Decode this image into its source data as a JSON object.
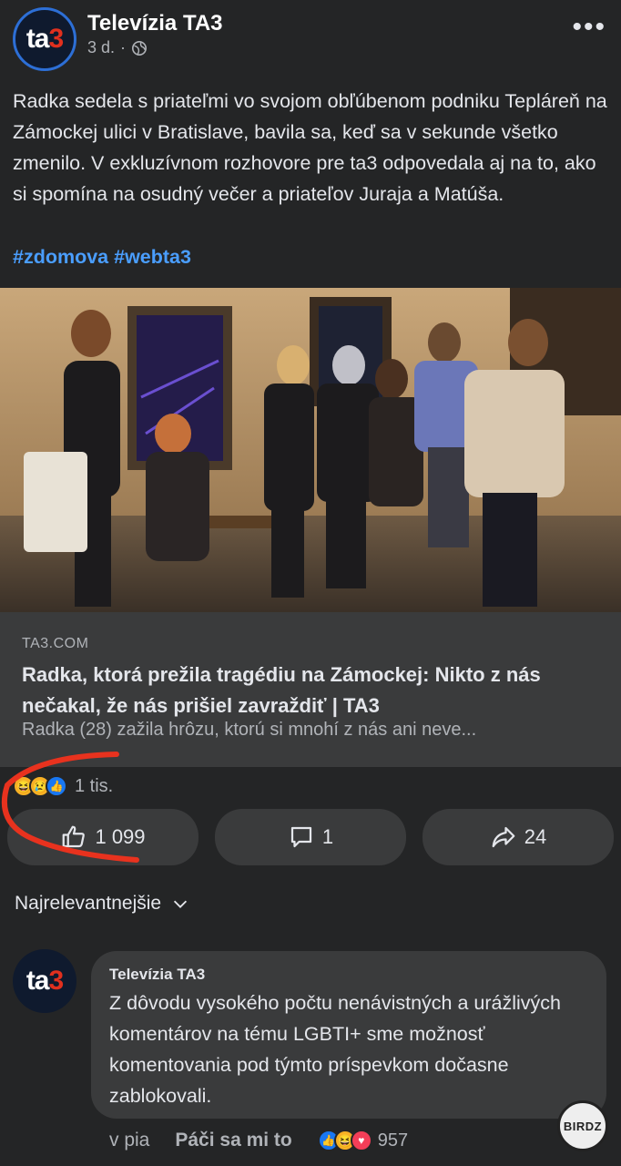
{
  "post": {
    "page_name": "Televízia TA3",
    "time": "3 d.",
    "separator": "·",
    "avatar_text": "ta",
    "avatar_digit": "3",
    "text": "Radka sedela s priateľmi vo svojom obľúbenom podniku Tepláreň na Zámockej ulici v Bratislave, bavila sa, keď sa v sekunde všetko zmenilo. V exkluzívnom rozhovore pre ta3 odpovedala aj na to, ako si spomína na osudný večer a priateľov Juraja a Matúša.",
    "hashtags": "#zdomova #webta3",
    "more_icon": "•••"
  },
  "link": {
    "domain": "TA3.COM",
    "title": "Radka, ktorá prežila tragédiu na Zámockej: Nikto z nás nečakal, že nás prišiel zavraždiť | TA3",
    "description": "Radka (28) zažila hrôzu, ktorú si mnohí z nás ani neve..."
  },
  "reactions": {
    "count": "1 tis.",
    "icons": [
      "haha-icon",
      "sad-icon",
      "like-icon"
    ]
  },
  "actions": {
    "like_count": "1 099",
    "comment_count": "1",
    "share_count": "24"
  },
  "comments": {
    "sort_label": "Najrelevantnejšie",
    "items": [
      {
        "author": "Televízia TA3",
        "text": "Z dôvodu vysokého počtu nenávistných a urážlivých komentárov na tému LGBTI+ sme možnosť komentovania pod týmto príspevkom dočasne zablokovali.",
        "time": "v pia",
        "like_label": "Páči sa mi to",
        "reaction_count": "957"
      }
    ]
  },
  "watermark": "BIRDZ",
  "colors": {
    "background": "#242526",
    "card": "#3a3b3c",
    "hashtag": "#4a9eff",
    "annotation": "#e8321e"
  }
}
